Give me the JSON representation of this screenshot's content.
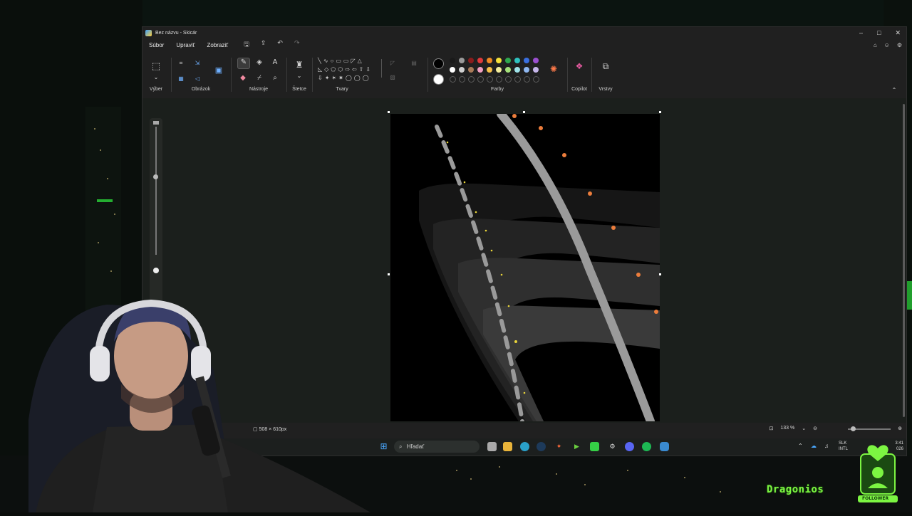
{
  "window": {
    "title": "Bez názvu - Skicár",
    "controls": {
      "minimize": "–",
      "maximize": "□",
      "close": "✕"
    }
  },
  "menu": {
    "items": [
      "Súbor",
      "Upraviť",
      "Zobraziť"
    ]
  },
  "ribbon": {
    "groups": {
      "selection": "Výber",
      "image": "Obrázok",
      "tools": "Nástroje",
      "brushes": "Štetce",
      "shapes": "Tvary",
      "colors": "Farby",
      "copilot": "Copilot",
      "layers": "Vrstvy"
    },
    "palette_row1": [
      "#1a1a1a",
      "#9a9a9a",
      "#8a1c1c",
      "#e03a3a",
      "#f08a24",
      "#f5e13a",
      "#2fa84f",
      "#2fc2c0",
      "#3a6fe0",
      "#9b4fd0"
    ],
    "palette_row2": [
      "#ffffff",
      "#cfcfcf",
      "#a97a58",
      "#f2a0c2",
      "#f6c14a",
      "#f3ee9c",
      "#a4e07a",
      "#9fe3ea",
      "#8fb7f0",
      "#c6b6ea"
    ],
    "current_colors": {
      "primary": "#000000",
      "secondary": "#ffffff"
    }
  },
  "status": {
    "canvas_size": "508 × 610px",
    "zoom": "133 %"
  },
  "taskbar": {
    "search_placeholder": "Hľadať",
    "keyboard_lang_1": "SLK",
    "keyboard_lang_2": "INTL",
    "clock_time": "3:41",
    "clock_date": "026"
  },
  "overlay": {
    "streamer_name": "Dragonios",
    "badge_label": "FOLLOWER"
  }
}
